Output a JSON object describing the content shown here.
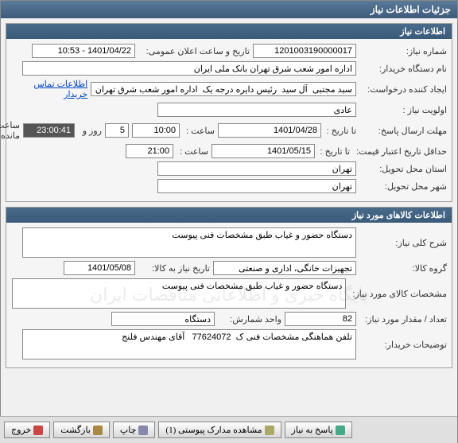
{
  "window_title": "جزئیات اطلاعات نیاز",
  "section1_title": "اطلاعات نیاز",
  "section2_title": "اطلاعات کالاهای مورد نیاز",
  "labels": {
    "request_no": "شماره نیاز:",
    "announce_date": "تاریخ و ساعت اعلان عمومی:",
    "buyer_org": "نام دستگاه خریدار:",
    "creator": "ایجاد کننده درخواست:",
    "contact_link": "اطلاعات تماس خریدار",
    "priority": "اولویت نیاز :",
    "reply_deadline": "مهلت ارسال پاسخ:",
    "to_date": "تا تاریخ :",
    "time": "ساعت :",
    "days_and": "روز و",
    "remaining": "ساعت باقی مانده",
    "price_validity": "حداقل تاریخ اعتبار قیمت:",
    "delivery_province": "استان محل تحویل:",
    "delivery_city": "شهر محل تحویل:",
    "general_desc": "شرح کلی نیاز:",
    "goods_group": "گروه کالا:",
    "need_date": "تاریخ نیاز به کالا:",
    "item_spec": "مشخصات کالای مورد نیاز:",
    "qty": "تعداد / مقدار مورد نیاز:",
    "unit": "واحد شمارش:",
    "buyer_notes": "توضیحات خریدار:"
  },
  "values": {
    "request_no": "1201003190000017",
    "announce_date": "1401/04/22 - 10:53",
    "buyer_org": "اداره امور شعب شرق تهران بانک ملی ایران",
    "creator": "سید مجتبی  آل سید  رئیس دایره درجه یک  اداره امور شعب شرق تهران بانک م",
    "priority": "عادی",
    "reply_to_date": "1401/04/28",
    "reply_time": "10:00",
    "days_left": "5",
    "countdown": "23:00:41",
    "price_to_date": "1401/05/15",
    "price_time": "21:00",
    "province": "تهران",
    "city": "تهران",
    "general_desc": "دستگاه حضور و غیاب طبق مشخصات فنی پیوست",
    "goods_group": "تجهیزات خانگی، اداری و صنعتی",
    "need_date": "1401/05/08",
    "item_spec": "دستگاه حضور و غیاب طبق مشخصات فنی پیوست",
    "qty": "82",
    "unit": "دستگاه",
    "buyer_notes": "تلفن هماهنگی مشخصات فنی ک  77624072   آقای مهندس فلنج"
  },
  "watermark": "پایگاه خبری و اطلاعاتی مناقصات ایران",
  "buttons": {
    "reply": "پاسخ به نیاز",
    "attachments": "مشاهده مدارک پیوستی (1)",
    "print": "چاپ",
    "back": "بازگشت",
    "exit": "خروج"
  }
}
